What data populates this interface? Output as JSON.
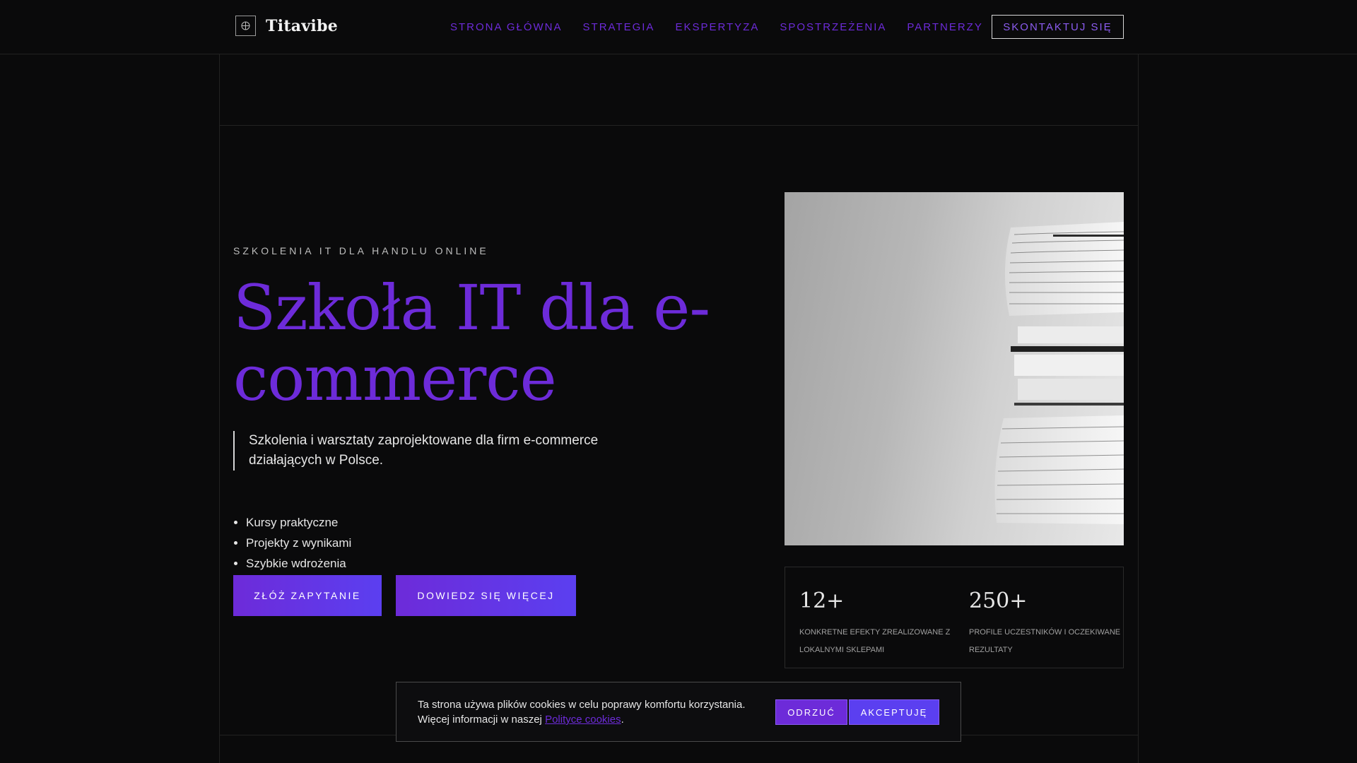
{
  "brand": {
    "name": "Titavibe",
    "icon": "globe-icon"
  },
  "nav": {
    "items": [
      {
        "label": "STRONA GŁÓWNA"
      },
      {
        "label": "STRATEGIA"
      },
      {
        "label": "EKSPERTYZA"
      },
      {
        "label": "SPOSTRZEŻENIA"
      },
      {
        "label": "PARTNERZY"
      }
    ],
    "contact_label": "SKONTAKTUJ SIĘ"
  },
  "hero": {
    "eyebrow": "SZKOLENIA IT DLA HANDLU ONLINE",
    "title": "Szkoła IT dla e-commerce",
    "lead": "Szkolenia i warsztaty zaprojektowane dla firm e-commerce działających w Polsce.",
    "bullets": [
      "Kursy praktyczne",
      "Projekty z wynikami",
      "Szybkie wdrożenia"
    ],
    "primary_cta": "ZŁÓŻ ZAPYTANIE",
    "secondary_cta": "DOWIEDZ SIĘ WIĘCEJ"
  },
  "stats": [
    {
      "value": "12+",
      "label": "KONKRETNE EFEKTY ZREALIZOWANE Z LOKALNYMI SKLEPAMI"
    },
    {
      "value": "250+",
      "label": "PROFILE UCZESTNIKÓW I OCZEKIWANE REZULTATY"
    }
  ],
  "cookie": {
    "text_line1": "Ta strona używa plików cookies w celu poprawy komfortu korzystania.",
    "text_line2_prefix": "Więcej informacji w naszej ",
    "link_text": "Polityce cookies",
    "text_suffix": ".",
    "reject_label": "ODRZUĆ",
    "accept_label": "AKCEPTUJĘ"
  },
  "colors": {
    "accent": "#6d2bd9",
    "accent_alt": "#5b3ff0",
    "background": "#0a0a0b"
  }
}
